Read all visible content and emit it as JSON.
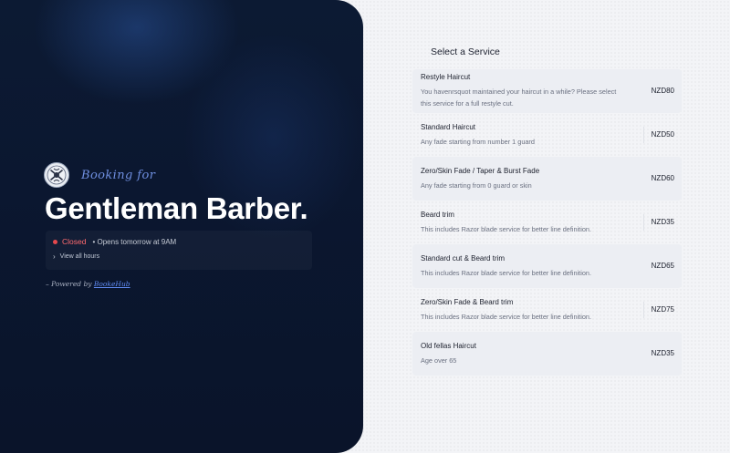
{
  "business": {
    "booking_for": "Booking for",
    "name": "Gentleman Barber.",
    "status": "Closed",
    "opens": "• Opens tomorrow at 9AM",
    "view_hours": "View all hours",
    "powered_prefix": "– Powered by ",
    "powered_link": "BookeHub"
  },
  "services_section": {
    "title": "Select a Service",
    "items": [
      {
        "name": "Restyle Haircut",
        "desc": "You havenrsquot maintained your haircut in a while? Please select this service for a full restyle cut.",
        "price": "NZD80"
      },
      {
        "name": "Standard Haircut",
        "desc": "Any fade starting from number 1 guard",
        "price": "NZD50"
      },
      {
        "name": "Zero/Skin Fade / Taper & Burst Fade",
        "desc": "Any fade starting from 0 guard or skin",
        "price": "NZD60"
      },
      {
        "name": "Beard trim",
        "desc": "This includes Razor blade service for better line definition.",
        "price": "NZD35"
      },
      {
        "name": "Standard cut & Beard trim",
        "desc": "This includes Razor blade service for better line definition.",
        "price": "NZD65"
      },
      {
        "name": "Zero/Skin Fade & Beard trim",
        "desc": "This includes Razor blade service for better line definition.",
        "price": "NZD75"
      },
      {
        "name": "Old fellas Haircut",
        "desc": "Age over 65",
        "price": "NZD35"
      }
    ]
  },
  "colors": {
    "panel_dark": "#0b1730",
    "accent_blue": "#6f8fe0",
    "closed_red": "#e5484d"
  }
}
